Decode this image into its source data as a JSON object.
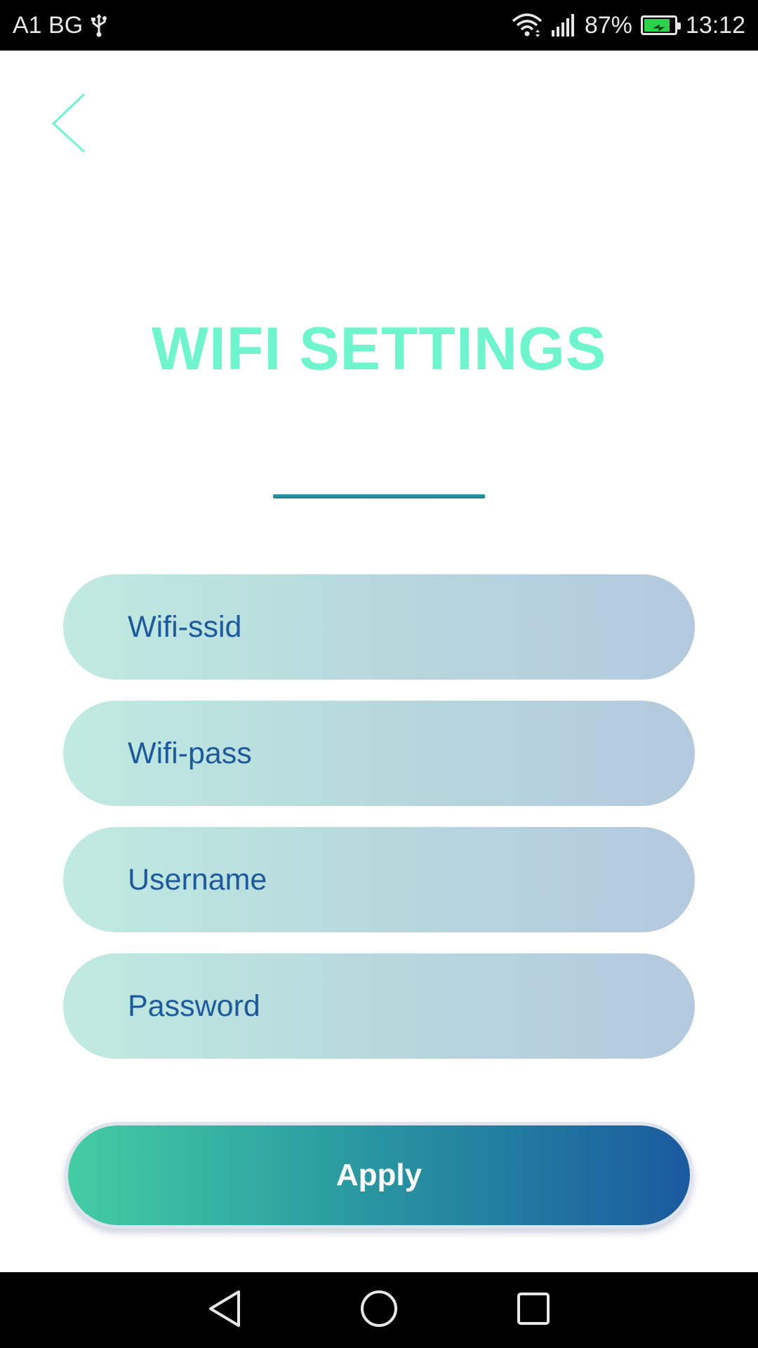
{
  "status_bar": {
    "carrier": "A1 BG",
    "battery_percent": "87%",
    "battery_level": 0.87,
    "time": "13:12",
    "icons": [
      "usb-icon",
      "wifi-icon",
      "signal-icon",
      "battery-icon"
    ]
  },
  "header": {
    "back_icon": "chevron-left-icon",
    "title": "WIFI SETTINGS"
  },
  "form": {
    "fields": [
      {
        "placeholder": "Wifi-ssid",
        "value": ""
      },
      {
        "placeholder": "Wifi-pass",
        "value": ""
      },
      {
        "placeholder": "Username",
        "value": ""
      },
      {
        "placeholder": "Password",
        "value": ""
      }
    ],
    "apply_label": "Apply"
  },
  "colors": {
    "title": "#6ff5cd",
    "field_text": "#1d5a9c",
    "apply_gradient_start": "#44cda3",
    "apply_gradient_end": "#1a5a9f",
    "battery_fill": "#2bd34b"
  },
  "nav_bar": {
    "icons": [
      "nav-back-icon",
      "nav-home-icon",
      "nav-recents-icon"
    ]
  }
}
